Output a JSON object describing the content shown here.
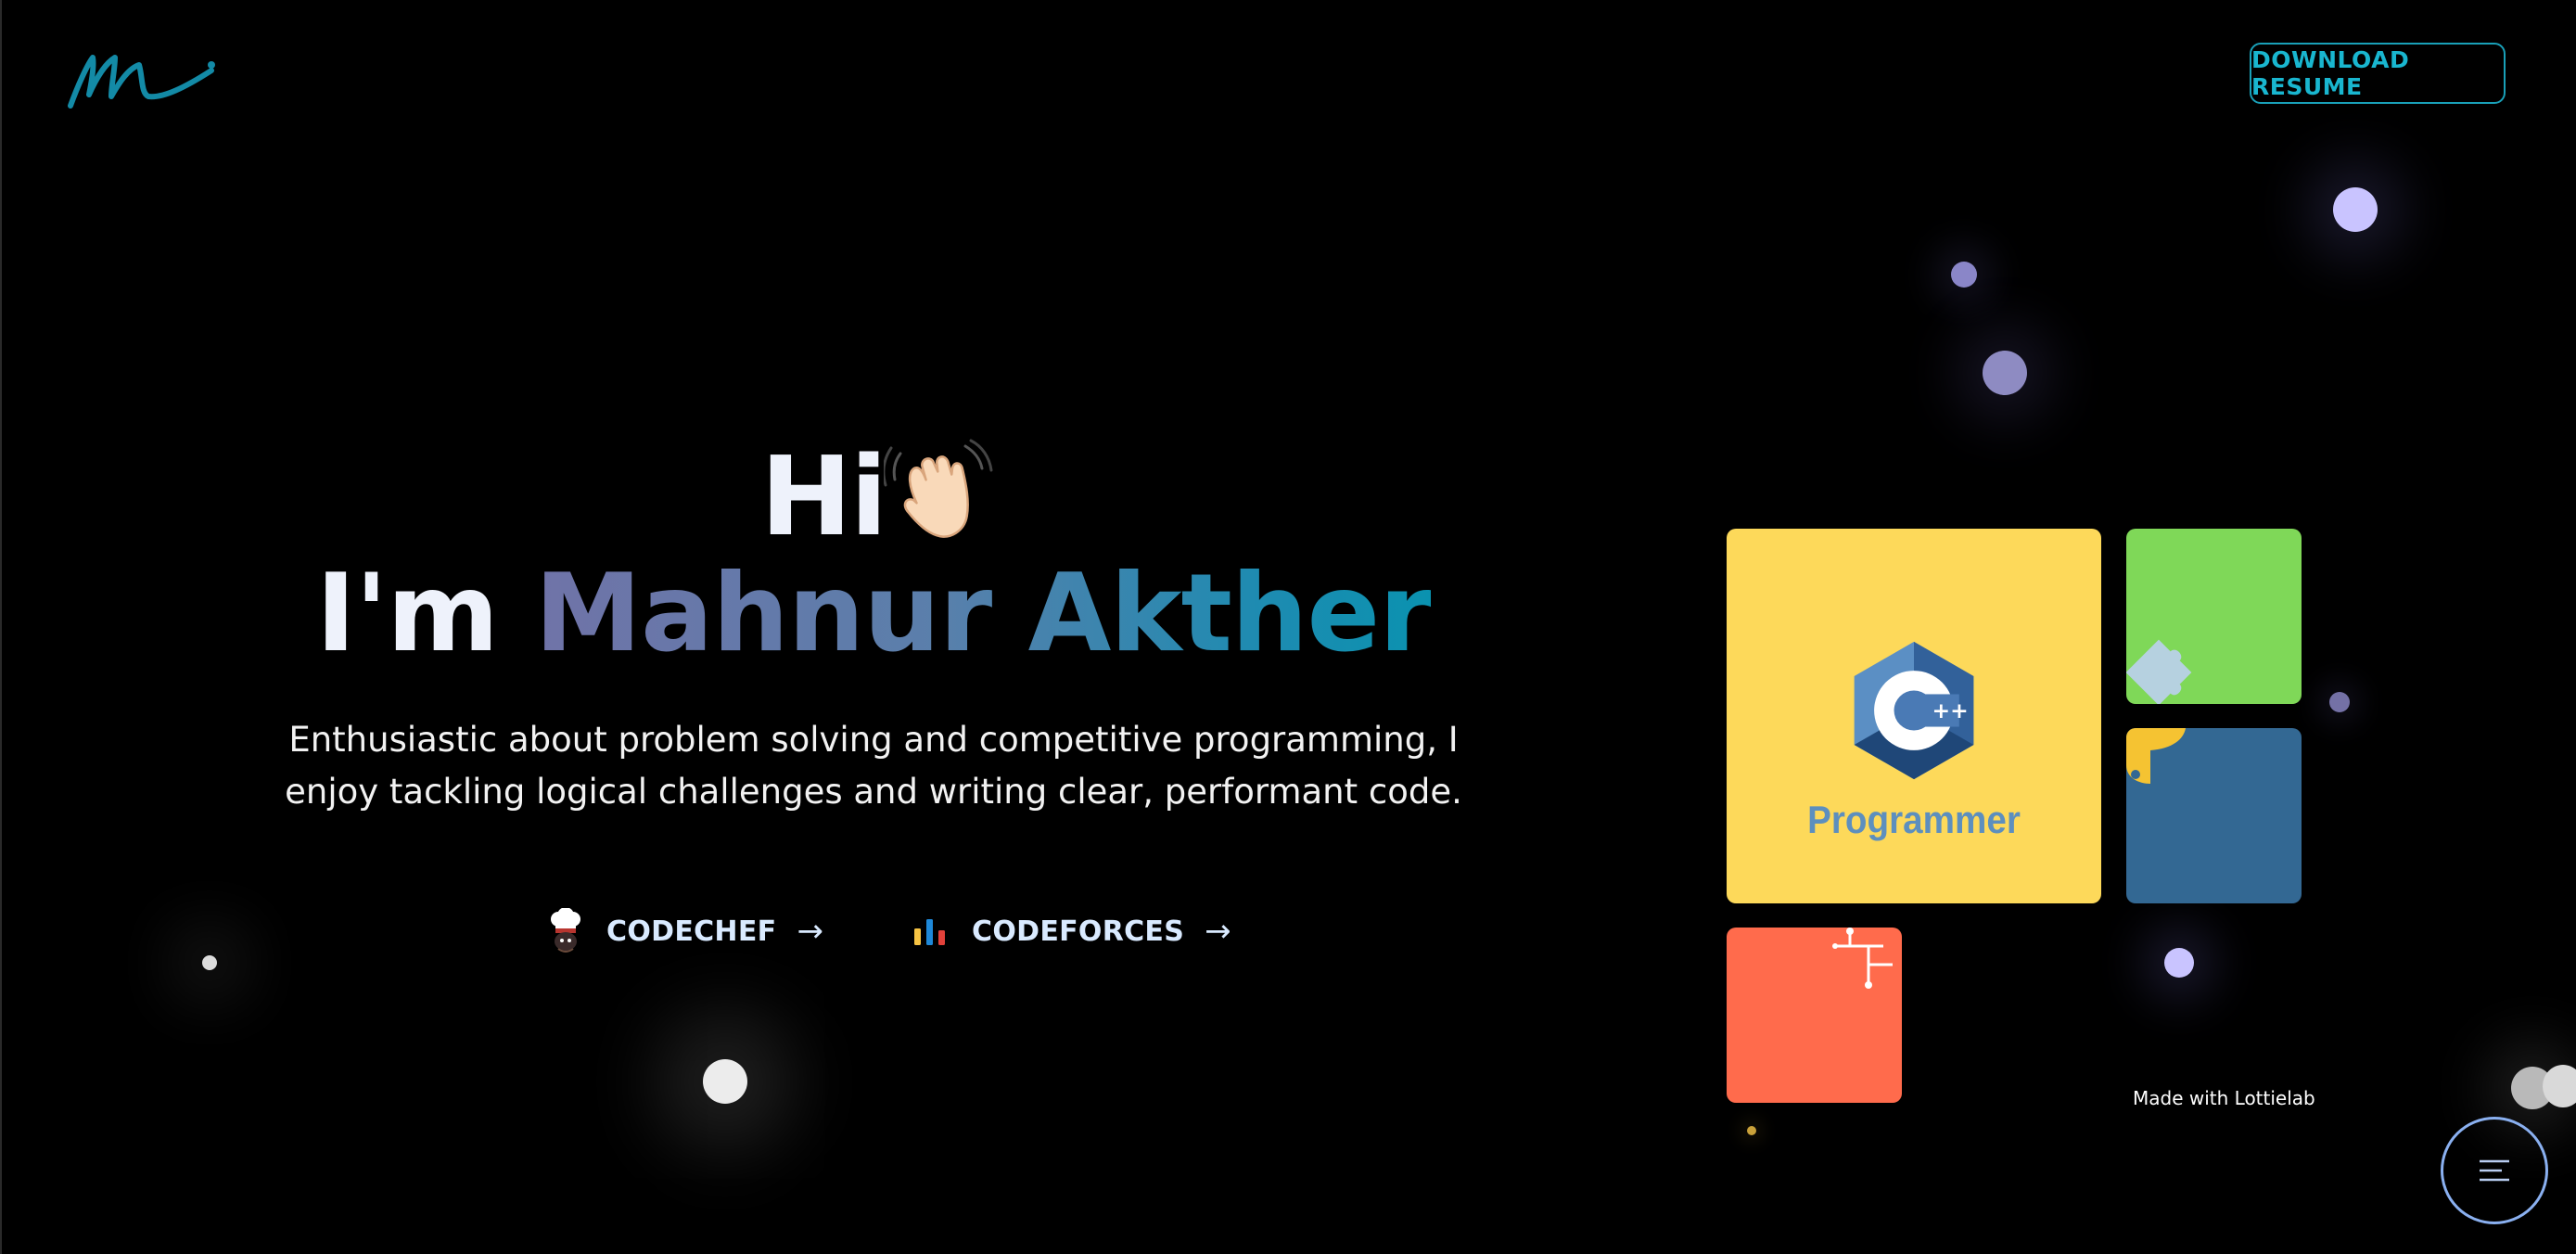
{
  "header": {
    "logo_icon": "signature-m-logo",
    "resume_label": "DOWNLOAD RESUME"
  },
  "hero": {
    "greeting": "Hi",
    "greeting_icon": "waving-hand-icon",
    "name_prefix": "I'm",
    "name": "Mahnur Akther",
    "intro": "Enthusiastic about problem solving and competitive programming, I enjoy tackling logical challenges and writing clear, performant code."
  },
  "links": [
    {
      "label": "CODECHEF",
      "icon": "chef-hat-icon",
      "arrow": "→"
    },
    {
      "label": "CODEFORCES",
      "icon": "bar-chart-icon",
      "arrow": "→"
    }
  ],
  "animation": {
    "center_label": "Programmer",
    "center_icon": "cpp-logo-icon",
    "credit": "Made with Lottielab",
    "colors": {
      "yellow": "#fdd95a",
      "green": "#7fd858",
      "blue": "#336893",
      "red": "#ff6b4c"
    }
  },
  "menu": {
    "icon": "menu-lines-icon"
  },
  "colors": {
    "accent": "#19b6cf",
    "background": "#000000"
  }
}
